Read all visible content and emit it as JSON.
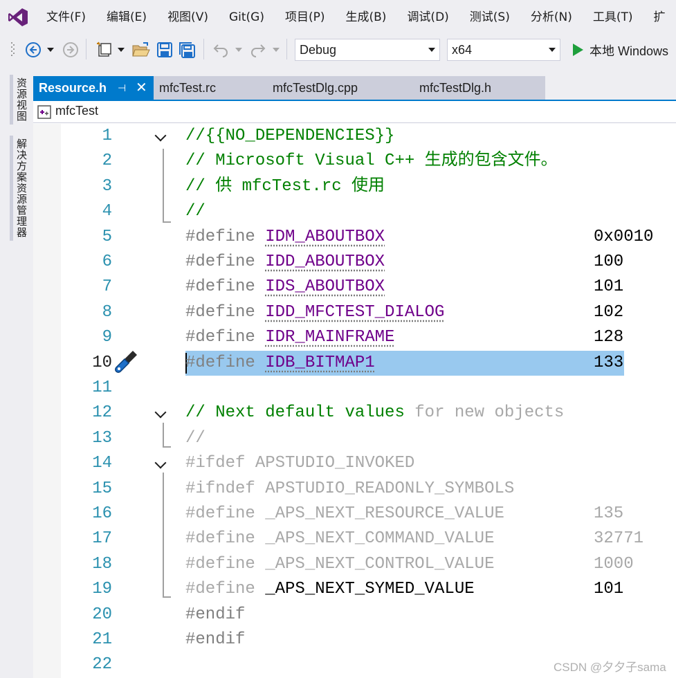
{
  "menu": [
    "文件(F)",
    "编辑(E)",
    "视图(V)",
    "Git(G)",
    "项目(P)",
    "生成(B)",
    "调试(D)",
    "测试(S)",
    "分析(N)",
    "工具(T)",
    "扩"
  ],
  "toolbar": {
    "config": "Debug",
    "platform": "x64",
    "run_label": "本地 Windows"
  },
  "left_tabs": [
    "资源视图",
    "解决方案资源管理器"
  ],
  "tabs": [
    {
      "label": "Resource.h",
      "active": true
    },
    {
      "label": "mfcTest.rc",
      "active": false
    },
    {
      "label": "mfcTestDlg.cpp",
      "active": false
    },
    {
      "label": "mfcTestDlg.h",
      "active": false
    }
  ],
  "nav": {
    "project": "mfcTest"
  },
  "code_lines": [
    {
      "n": "1",
      "fold": true,
      "parts": [
        {
          "t": "//{{NO_DEPENDENCIES}}",
          "c": "c-comment"
        }
      ]
    },
    {
      "n": "2",
      "parts": [
        {
          "t": "// Microsoft Visual C++ 生成的包含文件。",
          "c": "c-comment"
        }
      ]
    },
    {
      "n": "3",
      "parts": [
        {
          "t": "// 供 mfcTest.rc 使用",
          "c": "c-comment"
        }
      ]
    },
    {
      "n": "4",
      "parts": [
        {
          "t": "//",
          "c": "c-comment"
        }
      ]
    },
    {
      "n": "5",
      "parts": [
        {
          "t": "#define ",
          "c": "c-gray"
        },
        {
          "t": "IDM_ABOUTBOX",
          "c": "c-macro dots"
        }
      ],
      "value": "0x0010"
    },
    {
      "n": "6",
      "parts": [
        {
          "t": "#define ",
          "c": "c-gray"
        },
        {
          "t": "IDD_ABOUTBOX",
          "c": "c-macro dots"
        }
      ],
      "value": "100"
    },
    {
      "n": "7",
      "parts": [
        {
          "t": "#define ",
          "c": "c-gray"
        },
        {
          "t": "IDS_ABOUTBOX",
          "c": "c-macro dots"
        }
      ],
      "value": "101"
    },
    {
      "n": "8",
      "parts": [
        {
          "t": "#define ",
          "c": "c-gray"
        },
        {
          "t": "IDD_MFCTEST_DIALOG",
          "c": "c-macro dots"
        }
      ],
      "value": "102"
    },
    {
      "n": "9",
      "parts": [
        {
          "t": "#define ",
          "c": "c-gray"
        },
        {
          "t": "IDR_MAINFRAME",
          "c": "c-macro dots"
        }
      ],
      "value": "128"
    },
    {
      "n": "10",
      "selected": true,
      "parts": [
        {
          "t": "#define ",
          "c": "c-gray"
        },
        {
          "t": "IDB_BITMAP1",
          "c": "c-macro dots"
        }
      ],
      "value": "133"
    },
    {
      "n": "11",
      "parts": []
    },
    {
      "n": "12",
      "fold": true,
      "parts": [
        {
          "t": "// Next default values ",
          "c": "c-comment"
        },
        {
          "t": "for new objects",
          "c": "c-dim"
        }
      ]
    },
    {
      "n": "13",
      "parts": [
        {
          "t": "//",
          "c": "c-dim"
        }
      ]
    },
    {
      "n": "14",
      "fold": true,
      "parts": [
        {
          "t": "#ifdef APSTUDIO_INVOKED",
          "c": "c-dim"
        }
      ]
    },
    {
      "n": "15",
      "parts": [
        {
          "t": "#ifndef APSTUDIO_READONLY_SYMBOLS",
          "c": "c-dim"
        }
      ]
    },
    {
      "n": "16",
      "parts": [
        {
          "t": "#define _APS_NEXT_RESOURCE_VALUE",
          "c": "c-dim"
        }
      ],
      "value": "135",
      "value_class": "c-dim"
    },
    {
      "n": "17",
      "parts": [
        {
          "t": "#define _APS_NEXT_COMMAND_VALUE",
          "c": "c-dim"
        }
      ],
      "value": "32771",
      "value_class": "c-dim"
    },
    {
      "n": "18",
      "parts": [
        {
          "t": "#define _APS_NEXT_CONTROL_VALUE",
          "c": "c-dim"
        }
      ],
      "value": "1000",
      "value_class": "c-dim"
    },
    {
      "n": "19",
      "parts": [
        {
          "t": "#define ",
          "c": "c-dim"
        },
        {
          "t": "_APS_NEXT_SYMED_VALUE",
          "c": "c-text"
        }
      ],
      "value": "101"
    },
    {
      "n": "20",
      "parts": [
        {
          "t": "#endif",
          "c": "c-gray"
        }
      ]
    },
    {
      "n": "21",
      "parts": [
        {
          "t": "#endif",
          "c": "c-gray"
        }
      ]
    },
    {
      "n": "22",
      "parts": []
    }
  ],
  "watermark": "CSDN @夕夕子sama"
}
